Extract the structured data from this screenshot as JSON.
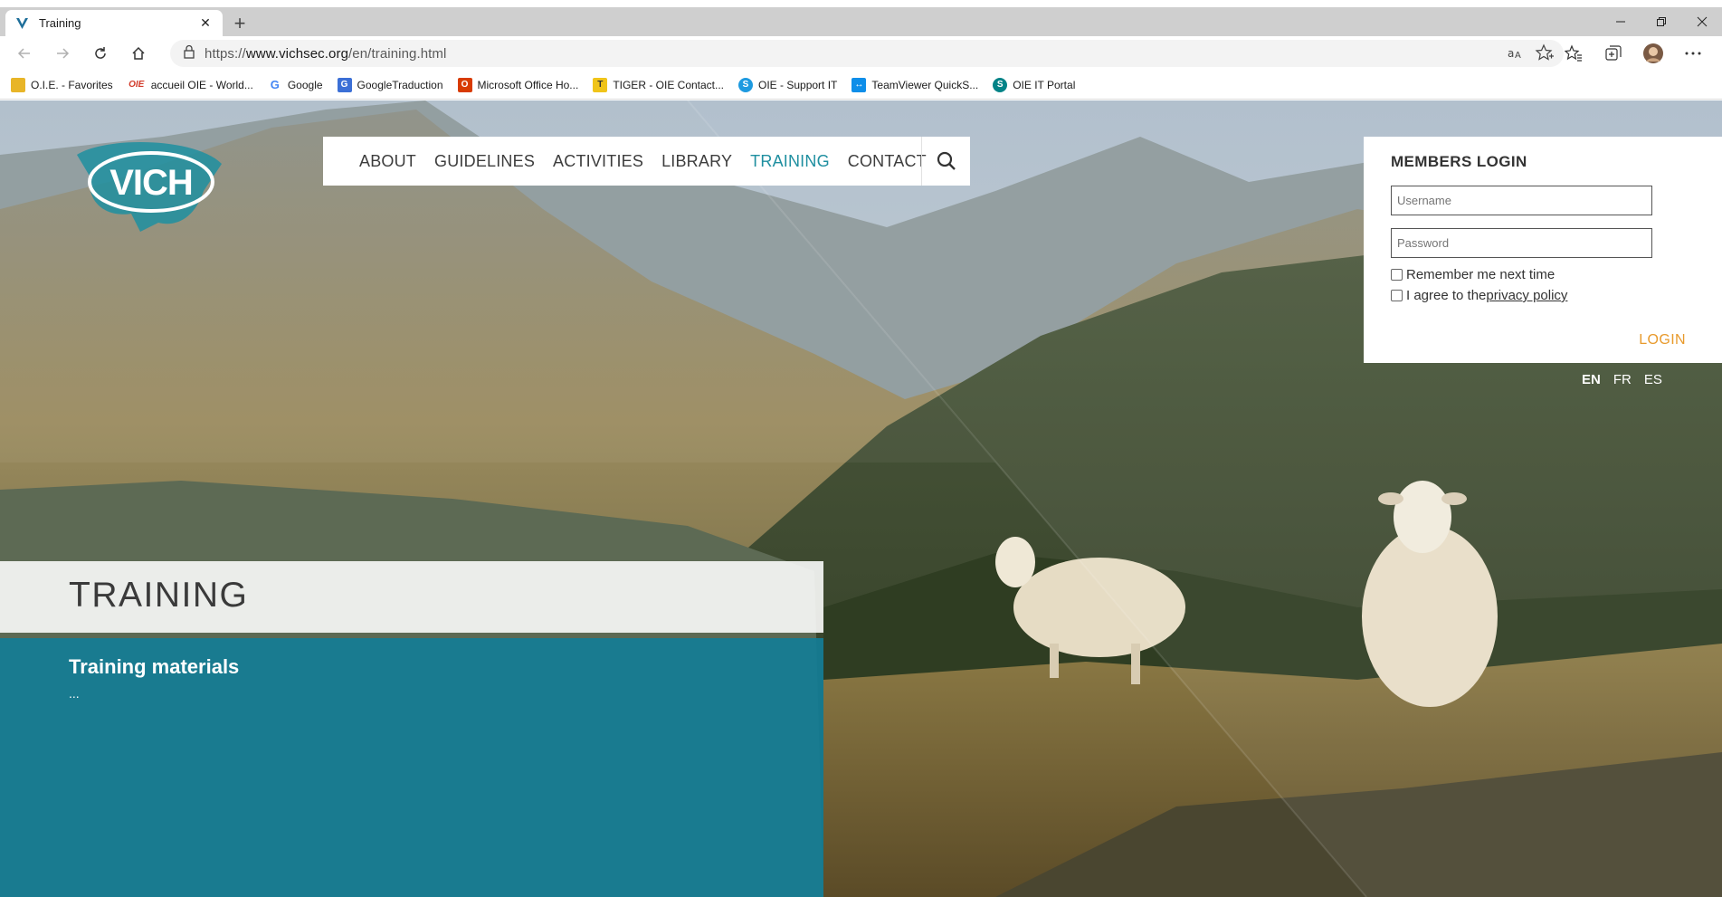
{
  "browser": {
    "tab_title": "Training",
    "new_tab": "+",
    "url_host": "www.vichsec.org",
    "url_prefix": "https://",
    "url_path": "/en/training.html",
    "window_controls": [
      "minimize-icon",
      "restore-icon",
      "close-icon"
    ],
    "bookmarks": [
      {
        "label": "O.I.E. - Favorites",
        "icon": "folder-icon",
        "color": "#e8b528"
      },
      {
        "label": "accueil OIE - World...",
        "icon": "oie-icon",
        "color": "#d23b2a"
      },
      {
        "label": "Google",
        "icon": "google-icon",
        "color": "#4285f4"
      },
      {
        "label": "GoogleTraduction",
        "icon": "translate-icon",
        "color": "#3b6fd6"
      },
      {
        "label": "Microsoft Office Ho...",
        "icon": "office-icon",
        "color": "#d83b01"
      },
      {
        "label": "TIGER - OIE Contact...",
        "icon": "tiger-icon",
        "color": "#f0c419"
      },
      {
        "label": "OIE - Support IT",
        "icon": "support-icon",
        "color": "#1e9ae0"
      },
      {
        "label": "TeamViewer QuickS...",
        "icon": "teamviewer-icon",
        "color": "#0e8ee9"
      },
      {
        "label": "OIE IT Portal",
        "icon": "sharepoint-icon",
        "color": "#038387"
      }
    ]
  },
  "site": {
    "logo_text": "VICH",
    "nav": [
      {
        "label": "ABOUT",
        "active": false
      },
      {
        "label": "GUIDELINES",
        "active": false
      },
      {
        "label": "ACTIVITIES",
        "active": false
      },
      {
        "label": "LIBRARY",
        "active": false
      },
      {
        "label": "TRAINING",
        "active": true
      },
      {
        "label": "CONTACT",
        "active": false
      }
    ],
    "accent_color": "#1f8fa0",
    "login": {
      "title": "MEMBERS LOGIN",
      "username_placeholder": "Username",
      "password_placeholder": "Password",
      "remember_label": "Remember me next time",
      "agree_prefix": "I agree to the ",
      "privacy_link": "privacy policy",
      "login_button": "LOGIN",
      "login_color": "#e89a2c"
    },
    "languages": [
      "EN",
      "FR",
      "ES"
    ],
    "active_language": "EN",
    "page_title": "TRAINING",
    "section_heading": "Training materials",
    "section_text": "..."
  }
}
